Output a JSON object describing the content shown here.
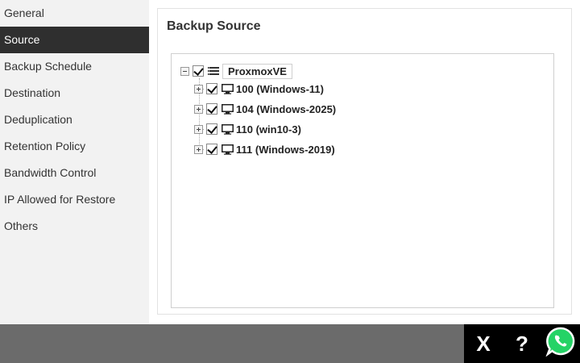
{
  "sidebar": {
    "items": [
      {
        "label": "General"
      },
      {
        "label": "Source",
        "active": true
      },
      {
        "label": "Backup Schedule"
      },
      {
        "label": "Destination"
      },
      {
        "label": "Deduplication"
      },
      {
        "label": "Retention Policy"
      },
      {
        "label": "Bandwidth Control"
      },
      {
        "label": "IP Allowed for Restore"
      },
      {
        "label": "Others"
      }
    ]
  },
  "main": {
    "title": "Backup Source",
    "tree": {
      "root": {
        "label": "ProxmoxVE",
        "checked": true,
        "expanded": true,
        "icon": "server-list-icon"
      },
      "children": [
        {
          "label": "100 (Windows-11)",
          "checked": true,
          "expanded": false,
          "icon": "monitor-icon"
        },
        {
          "label": "104 (Windows-2025)",
          "checked": true,
          "expanded": false,
          "icon": "monitor-icon"
        },
        {
          "label": "110 (win10-3)",
          "checked": true,
          "expanded": false,
          "icon": "monitor-icon"
        },
        {
          "label": "111 (Windows-2019)",
          "checked": true,
          "expanded": false,
          "icon": "monitor-icon"
        }
      ]
    }
  },
  "footer": {
    "close_label": "X",
    "help_label": "?",
    "whatsapp_icon": "whatsapp-icon",
    "whatsapp_color": "#25d366"
  },
  "colors": {
    "active_nav_bg": "#2f2f2f",
    "bottom_bar": "#6b6b6b",
    "actions_bg": "#000000"
  }
}
